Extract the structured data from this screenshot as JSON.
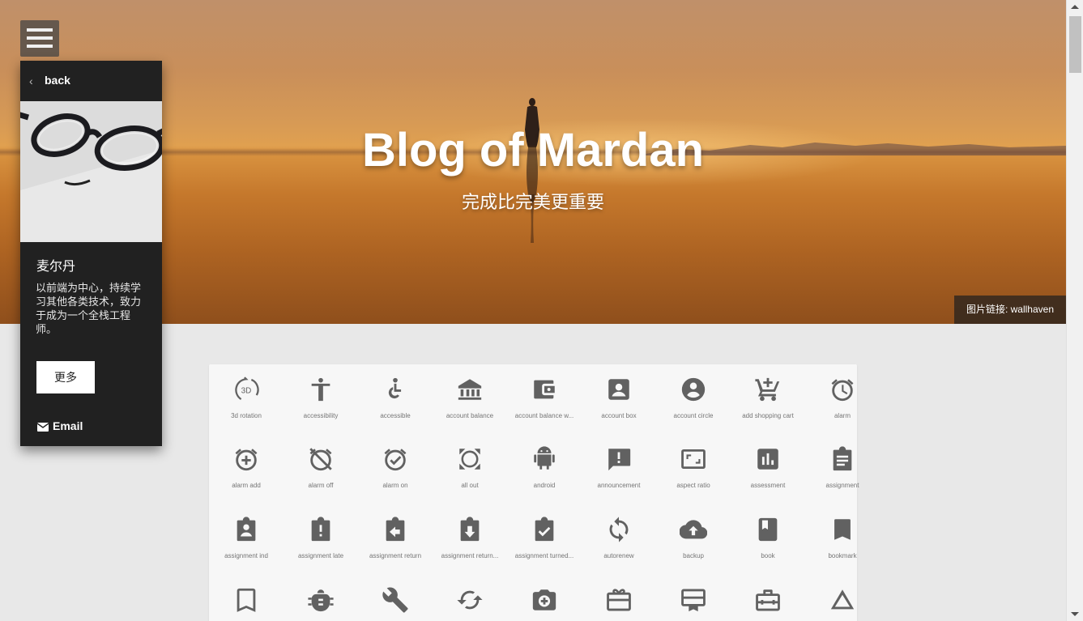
{
  "hero": {
    "title": "Blog of Mardan",
    "subtitle": "完成比完美更重要",
    "credit": "图片链接: wallhaven"
  },
  "panel": {
    "back_label": "back",
    "name": "麦尔丹",
    "bio": "以前端为中心，持续学习其他各类技术，致力于成为一个全栈工程师。",
    "more_label": "更多",
    "email_label": "Email"
  },
  "icons": [
    {
      "label": "3d rotation",
      "icon": "3d-rotation-icon"
    },
    {
      "label": "accessibility",
      "icon": "accessibility-icon"
    },
    {
      "label": "accessible",
      "icon": "accessible-icon"
    },
    {
      "label": "account balance",
      "icon": "account-balance-icon"
    },
    {
      "label": "account balance w...",
      "icon": "account-balance-wallet-icon"
    },
    {
      "label": "account box",
      "icon": "account-box-icon"
    },
    {
      "label": "account circle",
      "icon": "account-circle-icon"
    },
    {
      "label": "add shopping cart",
      "icon": "add-shopping-cart-icon"
    },
    {
      "label": "alarm",
      "icon": "alarm-icon"
    },
    {
      "label": "alarm add",
      "icon": "alarm-add-icon"
    },
    {
      "label": "alarm off",
      "icon": "alarm-off-icon"
    },
    {
      "label": "alarm on",
      "icon": "alarm-on-icon"
    },
    {
      "label": "all out",
      "icon": "all-out-icon"
    },
    {
      "label": "android",
      "icon": "android-icon"
    },
    {
      "label": "announcement",
      "icon": "announcement-icon"
    },
    {
      "label": "aspect ratio",
      "icon": "aspect-ratio-icon"
    },
    {
      "label": "assessment",
      "icon": "assessment-icon"
    },
    {
      "label": "assignment",
      "icon": "assignment-icon"
    },
    {
      "label": "assignment ind",
      "icon": "assignment-ind-icon"
    },
    {
      "label": "assignment late",
      "icon": "assignment-late-icon"
    },
    {
      "label": "assignment return",
      "icon": "assignment-return-icon"
    },
    {
      "label": "assignment return...",
      "icon": "assignment-returned-icon"
    },
    {
      "label": "assignment turned...",
      "icon": "assignment-turned-in-icon"
    },
    {
      "label": "autorenew",
      "icon": "autorenew-icon"
    },
    {
      "label": "backup",
      "icon": "backup-icon"
    },
    {
      "label": "book",
      "icon": "book-icon"
    },
    {
      "label": "bookmark",
      "icon": "bookmark-icon"
    },
    {
      "label": "",
      "icon": "bookmark-border-icon"
    },
    {
      "label": "",
      "icon": "bug-report-icon"
    },
    {
      "label": "",
      "icon": "build-icon"
    },
    {
      "label": "",
      "icon": "cached-icon"
    },
    {
      "label": "",
      "icon": "camera-enhance-icon"
    },
    {
      "label": "",
      "icon": "card-giftcard-icon"
    },
    {
      "label": "",
      "icon": "card-membership-icon"
    },
    {
      "label": "",
      "icon": "card-travel-icon"
    },
    {
      "label": "",
      "icon": "change-history-icon"
    }
  ]
}
